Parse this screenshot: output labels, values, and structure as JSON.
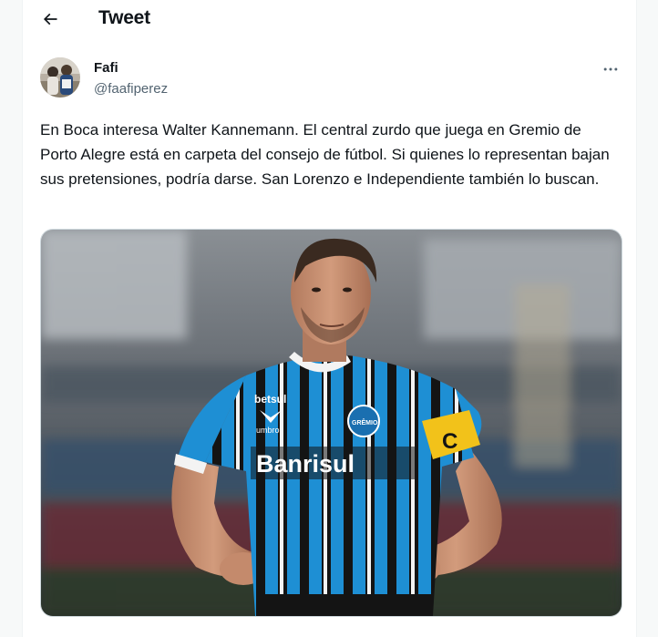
{
  "header": {
    "title": "Tweet",
    "back_icon": "arrow-left-icon"
  },
  "author": {
    "name": "Fafi",
    "handle": "@faafiperez",
    "avatar_icon": "avatar-photo"
  },
  "more_icon": "more-horizontal-icon",
  "tweet": {
    "text": "En Boca interesa Walter Kannemann. El central zurdo que juega en Gremio de Porto Alegre está en carpeta del consejo de fútbol. Si quienes lo representan bajan sus pretensiones, podría darse. San Lorenzo e Independiente también lo buscan."
  },
  "media": {
    "jersey_sponsor": "Banrisul",
    "jersey_brand": "betsul",
    "kit_maker": "umbro",
    "crest_text": "GRÊMIO",
    "armband_letter": "C"
  },
  "colors": {
    "text_primary": "#0f1419",
    "text_secondary": "#536471",
    "jersey_blue": "#1e8fd4",
    "jersey_black": "#141414",
    "armband_yellow": "#f2c21a"
  }
}
